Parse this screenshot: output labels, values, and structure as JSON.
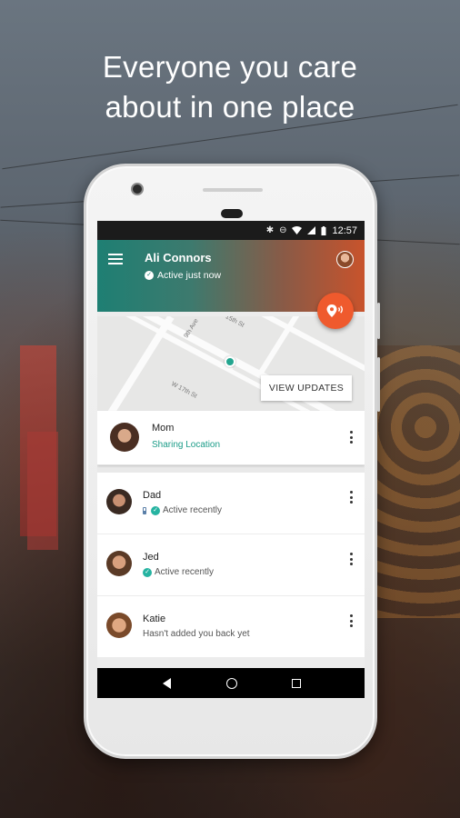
{
  "headline": {
    "line1": "Everyone you care",
    "line2": "about in one place"
  },
  "statusbar": {
    "time": "12:57",
    "icons": [
      "bluetooth-icon",
      "do-not-disturb-icon",
      "wifi-icon",
      "signal-icon",
      "battery-icon"
    ]
  },
  "appbar": {
    "menu_icon": "hamburger-menu-icon",
    "user_name": "Ali Connors",
    "user_status": "Active just now"
  },
  "map": {
    "streets": [
      "9th Ave",
      "W 17th St",
      "15th St"
    ],
    "view_updates_label": "VIEW UPDATES"
  },
  "contacts": [
    {
      "name": "Mom",
      "status": "Sharing Location"
    },
    {
      "name": "Dad",
      "status": "Active recently"
    },
    {
      "name": "Jed",
      "status": "Active recently"
    },
    {
      "name": "Katie",
      "status": "Hasn't added you back yet"
    }
  ],
  "colors": {
    "accent": "#ef5a2d",
    "teal": "#1e7f73",
    "active_check": "#26b3a1",
    "sharing_text": "#1b9c88"
  }
}
